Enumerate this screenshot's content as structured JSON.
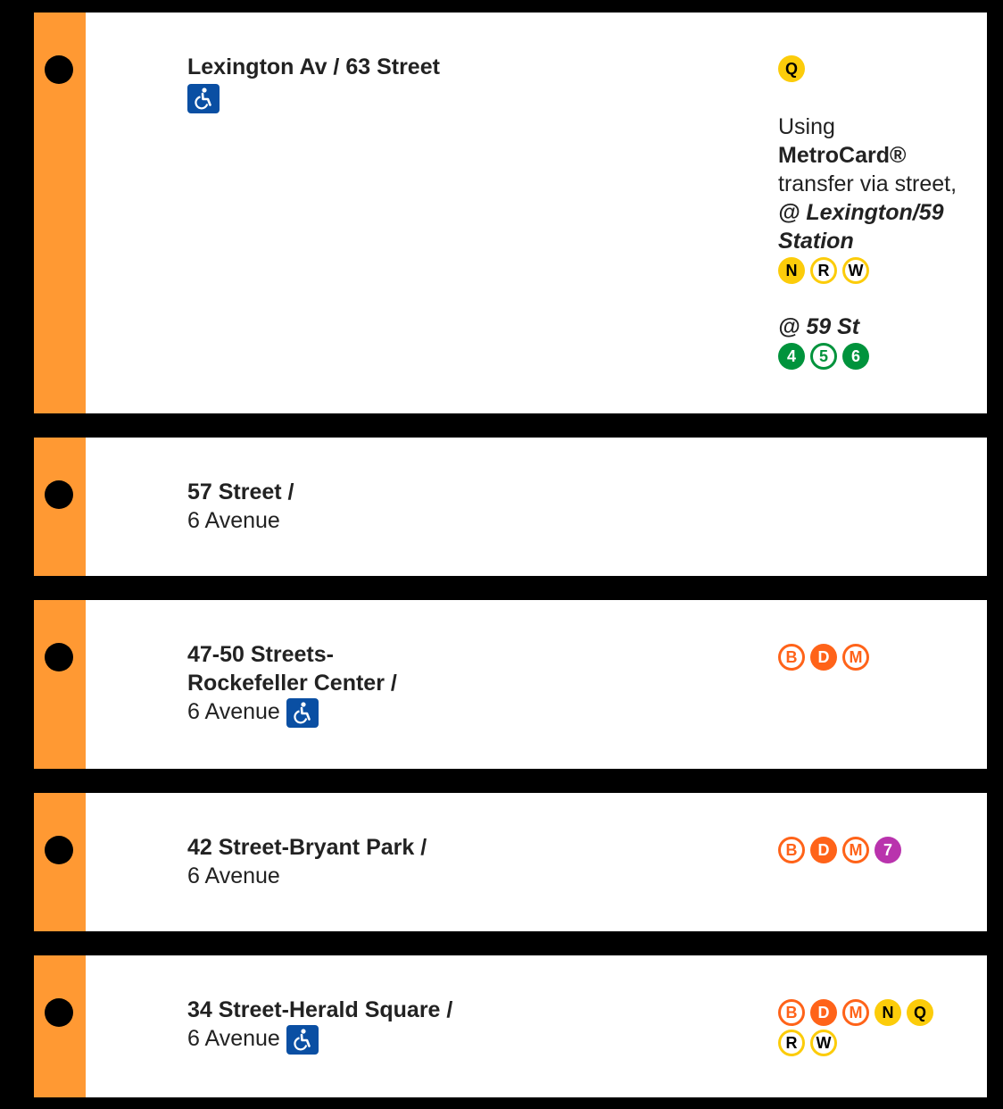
{
  "stations": [
    {
      "name_bold": "Lexington Av / 63 Street",
      "name_plain": "",
      "accessible": true,
      "service_bullets": [
        {
          "route": "Q",
          "color": "#fccc0a",
          "style": "yel"
        }
      ],
      "transfer": {
        "line1": "Using",
        "line2": "MetroCard®",
        "line3": "transfer via street,",
        "at1_symbol": "@",
        "at1_name": "Lexington/59 Station",
        "at1_bullets": [
          {
            "route": "N",
            "style": "yel"
          },
          {
            "route": "R",
            "style": "yel-x"
          },
          {
            "route": "W",
            "style": "yel-x"
          }
        ],
        "at2_symbol": "@",
        "at2_name": "59 St",
        "at2_bullets": [
          {
            "route": "4",
            "style": "grn"
          },
          {
            "route": "5",
            "style": "grn-x"
          },
          {
            "route": "6",
            "style": "grn"
          }
        ]
      }
    },
    {
      "name_bold": "57 Street /",
      "name_plain": "6 Avenue",
      "accessible": false,
      "service_bullets": []
    },
    {
      "name_bold": "47-50 Streets-",
      "name_bold_2": "Rockefeller Center /",
      "name_plain": "6 Avenue",
      "accessible": true,
      "service_bullets": [
        {
          "route": "B",
          "style": "org-x"
        },
        {
          "route": "D",
          "style": "org"
        },
        {
          "route": "M",
          "style": "org-x"
        }
      ]
    },
    {
      "name_bold": "42 Street-Bryant Park /",
      "name_plain": "6 Avenue",
      "accessible": false,
      "service_bullets": [
        {
          "route": "B",
          "style": "org-x"
        },
        {
          "route": "D",
          "style": "org"
        },
        {
          "route": "M",
          "style": "org-x"
        },
        {
          "route": "7",
          "style": "pur"
        }
      ]
    },
    {
      "name_bold": "34 Street-Herald Square /",
      "name_plain": "6 Avenue",
      "accessible": true,
      "service_bullets": [
        {
          "route": "B",
          "style": "org-x"
        },
        {
          "route": "D",
          "style": "org"
        },
        {
          "route": "M",
          "style": "org-x"
        },
        {
          "route": "N",
          "style": "yel"
        },
        {
          "route": "Q",
          "style": "yel"
        }
      ],
      "service_bullets_2": [
        {
          "route": "R",
          "style": "yel-x"
        },
        {
          "route": "W",
          "style": "yel-x"
        }
      ]
    }
  ],
  "colors": {
    "line_stripe": "#ff9933",
    "accessible_badge": "#0a4fa3",
    "background": "#000000",
    "row_background": "#ffffff"
  },
  "icons": {
    "accessible": "wheelchair-icon",
    "stop": "station-dot-icon"
  }
}
